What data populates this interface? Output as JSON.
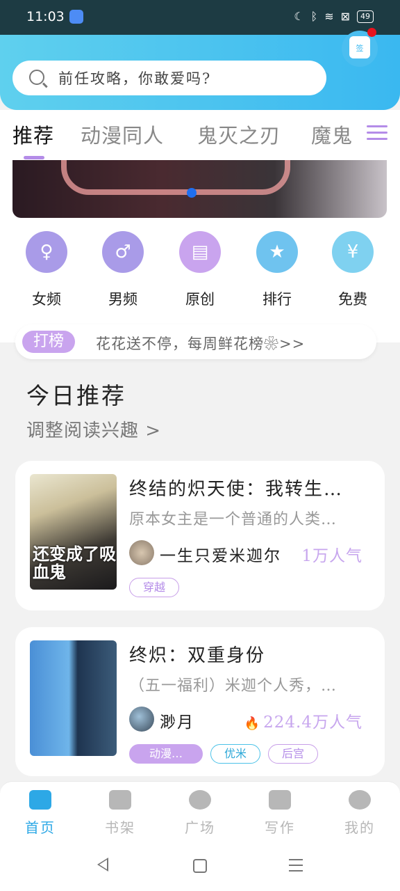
{
  "status_bar": {
    "time": "11:03",
    "battery": "49"
  },
  "header": {
    "search_placeholder": "前任攻略，你敢爱吗?",
    "sign_label": "签",
    "colors": {
      "accent": "#3ab8f0",
      "notification": "#e8131e"
    }
  },
  "tabs": [
    {
      "label": "推荐",
      "active": true
    },
    {
      "label": "动漫同人"
    },
    {
      "label": "鬼灭之刃"
    },
    {
      "label": "魔鬼"
    }
  ],
  "categories": [
    {
      "label": "女频",
      "icon": "dress-icon",
      "color": "#a99be8"
    },
    {
      "label": "男频",
      "icon": "shirt-icon",
      "color": "#a99be8"
    },
    {
      "label": "原创",
      "icon": "book-icon",
      "color": "#c9a4ee"
    },
    {
      "label": "排行",
      "icon": "trophy-icon",
      "color": "#6fc3ef"
    },
    {
      "label": "免费",
      "icon": "coin-icon",
      "color": "#7fd1f0"
    }
  ],
  "announcement": {
    "tag": "打榜",
    "text": "花花送不停，每周鲜花榜❀>>"
  },
  "section": {
    "title": "今日推荐",
    "subtitle": "调整阅读兴趣 >"
  },
  "books": [
    {
      "title": "终结的炽天使：我转生…",
      "description": "原本女主是一个普通的人类…",
      "author": "一生只爱米迦尔",
      "popularity": "1万人气",
      "cover_text": "还变成了吸血鬼",
      "tags": [
        "穿越"
      ]
    },
    {
      "title": "终炽：双重身份",
      "description": "（五一福利）米迦个人秀，…",
      "author": "渺月",
      "popularity": "224.4万人气",
      "tags": [
        "动漫…",
        "优米",
        "后宫"
      ]
    }
  ],
  "bottom_nav": [
    {
      "label": "首页",
      "icon": "home-icon",
      "active": true
    },
    {
      "label": "书架",
      "icon": "bookshelf-icon"
    },
    {
      "label": "广场",
      "icon": "planet-icon"
    },
    {
      "label": "写作",
      "icon": "pencil-icon"
    },
    {
      "label": "我的",
      "icon": "chat-icon"
    }
  ]
}
